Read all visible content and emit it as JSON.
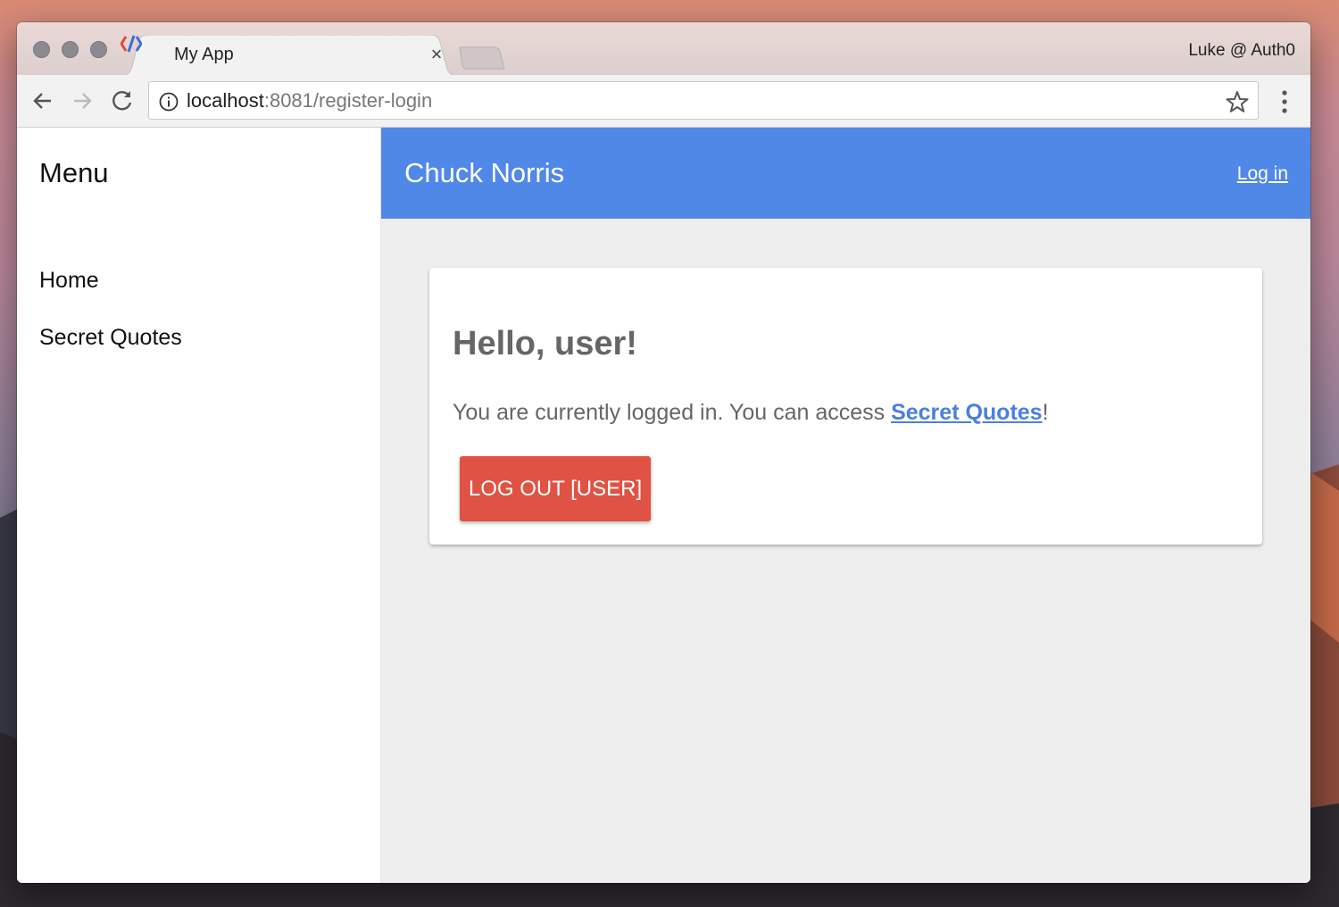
{
  "browser": {
    "tab": {
      "title": "My App",
      "close_glyph": "×"
    },
    "profile_name": "Luke @ Auth0",
    "url": {
      "host": "localhost",
      "path": ":8081/register-login"
    }
  },
  "sidebar": {
    "title": "Menu",
    "items": [
      {
        "label": "Home"
      },
      {
        "label": "Secret Quotes"
      }
    ]
  },
  "appbar": {
    "title": "Chuck Norris",
    "login_label": "Log in",
    "color": "#5088e8"
  },
  "card": {
    "heading": "Hello, user!",
    "text_before": "You are currently logged in. You can access ",
    "link_label": "Secret Quotes",
    "text_after": "!",
    "button_label": "LOG OUT [USER]",
    "button_color": "#e05243"
  },
  "icons": [
    "back-arrow-icon",
    "forward-arrow-icon",
    "reload-icon",
    "info-icon",
    "star-icon",
    "more-vert-icon",
    "tab-close-icon",
    "favicon-icon"
  ]
}
